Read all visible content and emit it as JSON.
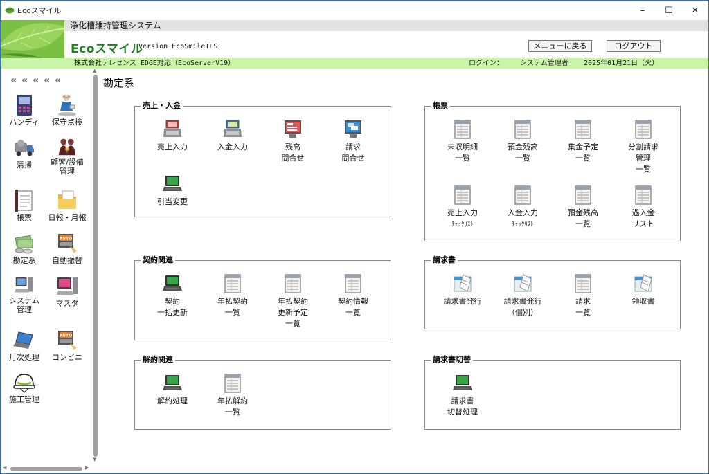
{
  "window": {
    "title": "Ecoスマイル",
    "minimize": "–",
    "maximize": "☐",
    "close": "✕"
  },
  "header": {
    "system_name": "浄化槽維持管理システム",
    "brand": "Ecoスマイル",
    "version": "Version EcoSmileTLS",
    "menu_button": "メニューに戻る",
    "logout_button": "ログアウト"
  },
  "infobar": {
    "company": "株式会社テレセンス EDGE対応（EcoServerV19）",
    "login_label": "ログイン：",
    "user": "システム管理者",
    "date": "2025年01月21日（火）"
  },
  "sidebar": {
    "collapse": "«««««",
    "items": [
      {
        "l1": "ハンディ",
        "l2": "",
        "icon": "handheld-icon"
      },
      {
        "l1": "保守点検",
        "l2": "",
        "icon": "maintenance-worker-icon"
      },
      {
        "l1": "清掃",
        "l2": "",
        "icon": "truck-icon"
      },
      {
        "l1": "顧客/設備",
        "l2": "管理",
        "icon": "customers-icon"
      },
      {
        "l1": "帳票",
        "l2": "",
        "icon": "report-icon"
      },
      {
        "l1": "日報・月報",
        "l2": "",
        "icon": "folder-icon"
      },
      {
        "l1": "勘定系",
        "l2": "",
        "icon": "money-icon"
      },
      {
        "l1": "自動振替",
        "l2": "",
        "icon": "auto-transfer-icon"
      },
      {
        "l1": "システム",
        "l2": "管理",
        "icon": "computer-icon"
      },
      {
        "l1": "マスタ",
        "l2": "",
        "icon": "master-icon"
      },
      {
        "l1": "月次処理",
        "l2": "",
        "icon": "laptop-icon"
      },
      {
        "l1": "コンビニ",
        "l2": "",
        "icon": "auto-transfer-icon"
      },
      {
        "l1": "施工管理",
        "l2": "",
        "icon": "helmet-icon"
      }
    ]
  },
  "page_title": "勘定系",
  "groups": {
    "sales": {
      "label": "売上・入金",
      "tiles": [
        {
          "l1": "売上入力",
          "l2": "",
          "l3": ""
        },
        {
          "l1": "入金入力",
          "l2": "",
          "l3": ""
        },
        {
          "l1": "残高",
          "l2": "問合せ",
          "l3": ""
        },
        {
          "l1": "請求",
          "l2": "問合せ",
          "l3": ""
        },
        {
          "l1": "引当変更",
          "l2": "",
          "l3": ""
        }
      ]
    },
    "reports": {
      "label": "帳票",
      "tiles": [
        {
          "l1": "未収明細",
          "l2": "一覧",
          "l3": ""
        },
        {
          "l1": "預金残高",
          "l2": "一覧",
          "l3": ""
        },
        {
          "l1": "集金予定",
          "l2": "一覧",
          "l3": ""
        },
        {
          "l1": "分割請求",
          "l2": "管理",
          "l3": "一覧"
        },
        {
          "l1": "売上入力",
          "l2": "ﾁｪｯｸﾘｽﾄ",
          "l3": ""
        },
        {
          "l1": "入金入力",
          "l2": "ﾁｪｯｸﾘｽﾄ",
          "l3": ""
        },
        {
          "l1": "預金残高",
          "l2": "一覧",
          "l3": ""
        },
        {
          "l1": "過入金",
          "l2": "リスト",
          "l3": ""
        }
      ]
    },
    "contract": {
      "label": "契約関連",
      "tiles": [
        {
          "l1": "契約",
          "l2": "一括更新",
          "l3": ""
        },
        {
          "l1": "年払契約",
          "l2": "一覧",
          "l3": ""
        },
        {
          "l1": "年払契約",
          "l2": "更新予定",
          "l3": "一覧"
        },
        {
          "l1": "契約情報",
          "l2": "一覧",
          "l3": ""
        }
      ]
    },
    "invoice": {
      "label": "請求書",
      "tiles": [
        {
          "l1": "請求書発行",
          "l2": "",
          "l3": ""
        },
        {
          "l1": "請求書発行",
          "l2": "（個別）",
          "l3": ""
        },
        {
          "l1": "請求",
          "l2": "一覧",
          "l3": ""
        },
        {
          "l1": "領収書",
          "l2": "",
          "l3": ""
        }
      ]
    },
    "cancel": {
      "label": "解約関連",
      "tiles": [
        {
          "l1": "解約処理",
          "l2": "",
          "l3": ""
        },
        {
          "l1": "年払解約",
          "l2": "一覧",
          "l3": ""
        }
      ]
    },
    "invoice_switch": {
      "label": "請求書切替",
      "tiles": [
        {
          "l1": "請求書",
          "l2": "切替処理",
          "l3": ""
        }
      ]
    }
  }
}
